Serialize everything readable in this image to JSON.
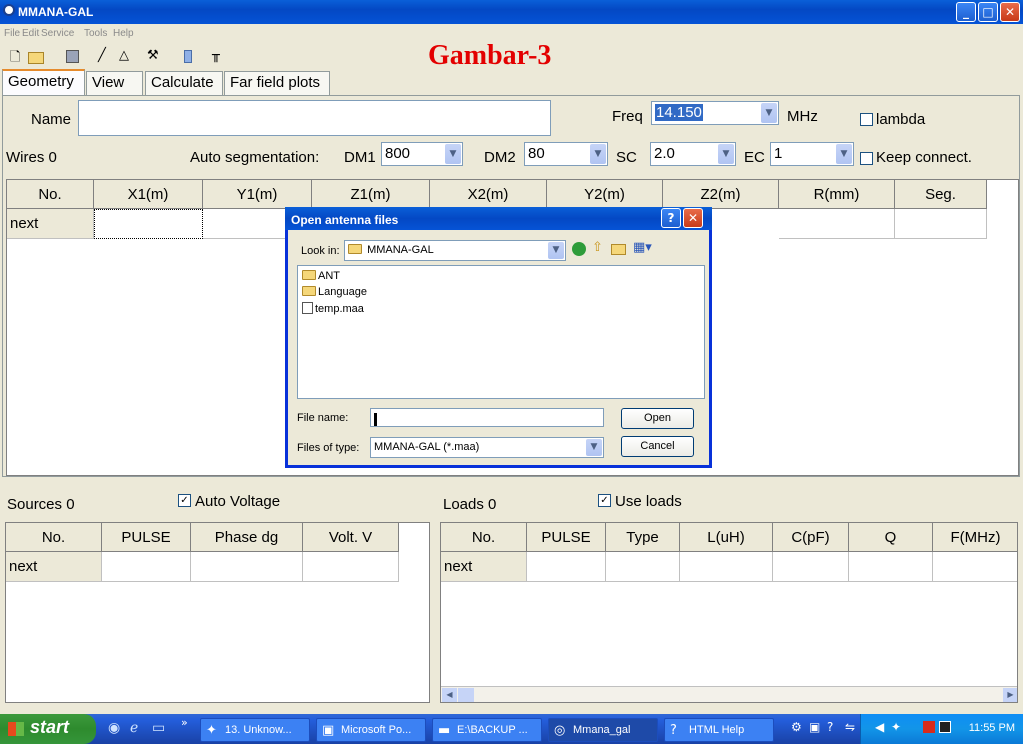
{
  "window": {
    "title": "MMANA-GAL",
    "min": "_",
    "max": "□",
    "close": "✕"
  },
  "menu": [
    "File",
    "Edit",
    "Service",
    "Tools",
    "Help"
  ],
  "toolbar_icons": [
    "new-file-icon",
    "open-folder-icon",
    "save-icon",
    "wire-icon",
    "triangle-icon",
    "tools-icon",
    "book-icon",
    "antenna-icon"
  ],
  "overlay_title": "Gambar-3",
  "tabs": [
    "Geometry",
    "View",
    "Calculate",
    "Far field plots"
  ],
  "geometry": {
    "name_label": "Name",
    "name_value": "",
    "freq_label": "Freq",
    "freq_value": "14.150",
    "freq_unit": "MHz",
    "lambda_label": "lambda",
    "wires_label": "Wires 0",
    "autoseg_label": "Auto segmentation:",
    "dm1_label": "DM1",
    "dm1_value": "800",
    "dm2_label": "DM2",
    "dm2_value": "80",
    "sc_label": "SC",
    "sc_value": "2.0",
    "ec_label": "EC",
    "ec_value": "1",
    "keep_label": "Keep connect.",
    "wire_columns": [
      "No.",
      "X1(m)",
      "Y1(m)",
      "Z1(m)",
      "X2(m)",
      "Y2(m)",
      "Z2(m)",
      "R(mm)",
      "Seg."
    ],
    "wire_row_first": "next"
  },
  "sources": {
    "label": "Sources 0",
    "auto_voltage_label": "Auto Voltage",
    "auto_voltage_checked": true,
    "columns": [
      "No.",
      "PULSE",
      "Phase dg",
      "Volt. V"
    ],
    "row_first": "next"
  },
  "loads": {
    "label": "Loads 0",
    "use_loads_label": "Use loads",
    "use_loads_checked": true,
    "columns": [
      "No.",
      "PULSE",
      "Type",
      "L(uH)",
      "C(pF)",
      "Q",
      "F(MHz)"
    ],
    "row_first": "next"
  },
  "dialog": {
    "title": "Open antenna files",
    "help": "?",
    "close": "✕",
    "look_in_label": "Look in:",
    "look_in_value": "MMANA-GAL",
    "files": [
      {
        "name": "ANT",
        "kind": "folder"
      },
      {
        "name": "Language",
        "kind": "folder"
      },
      {
        "name": "temp.maa",
        "kind": "file"
      }
    ],
    "file_name_label": "File name:",
    "file_name_value": "",
    "file_type_label": "Files of type:",
    "file_type_value": "MMANA-GAL (*.maa)",
    "open_label": "Open",
    "cancel_label": "Cancel"
  },
  "taskbar": {
    "start": "start",
    "tasks": [
      "13. Unknow...",
      "Microsoft Po...",
      "E:\\BACKUP ...",
      "Mmana_gal",
      "HTML Help"
    ],
    "clock": "11:55 PM"
  }
}
